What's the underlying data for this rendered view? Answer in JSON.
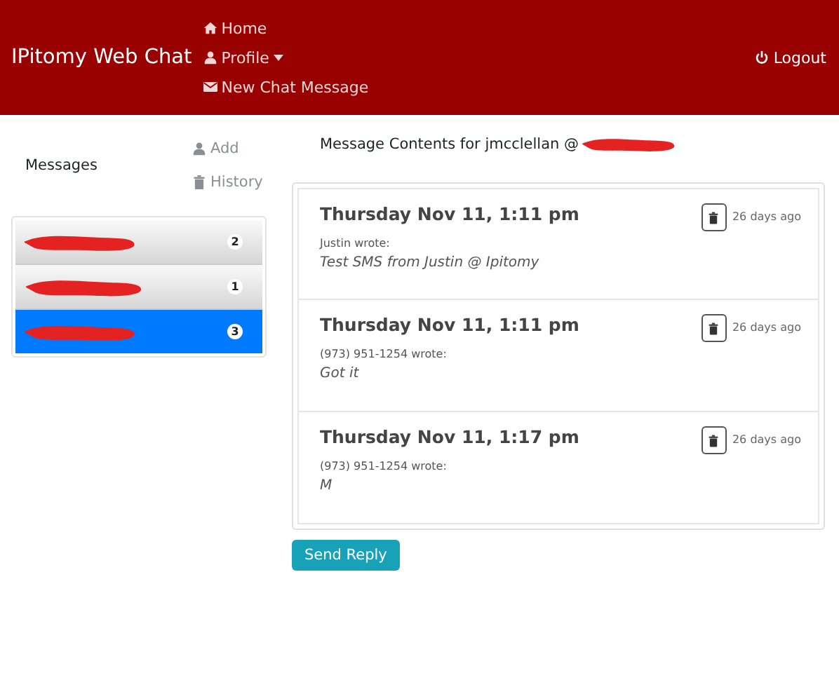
{
  "navbar": {
    "brand": "IPitomy Web Chat",
    "links": [
      {
        "kind": "home",
        "label": "Home"
      },
      {
        "kind": "profile",
        "label": "Profile"
      },
      {
        "kind": "compose",
        "label": "New Chat Message"
      }
    ],
    "logout": "Logout"
  },
  "sidebar": {
    "title": "Messages",
    "actions": [
      {
        "kind": "add",
        "label": "Add"
      },
      {
        "kind": "history",
        "label": "History"
      }
    ],
    "conversations": [
      {
        "badge": "2",
        "selected": false
      },
      {
        "badge": "1",
        "selected": false
      },
      {
        "badge": "3",
        "selected": true
      }
    ]
  },
  "content": {
    "heading": "Message Contents for jmcclellan @",
    "messages": [
      {
        "date": "Thursday Nov 11, 1:11 pm",
        "age": "26 days ago",
        "author": "Justin wrote:",
        "text": "Test SMS from Justin @ Ipitomy"
      },
      {
        "date": "Thursday Nov 11, 1:11 pm",
        "age": "26 days ago",
        "author": "(973) 951-1254 wrote:",
        "text": "Got it"
      },
      {
        "date": "Thursday Nov 11, 1:17 pm",
        "age": "26 days ago",
        "author": "(973) 951-1254 wrote:",
        "text": "M"
      }
    ],
    "reply_button": "Send Reply"
  }
}
